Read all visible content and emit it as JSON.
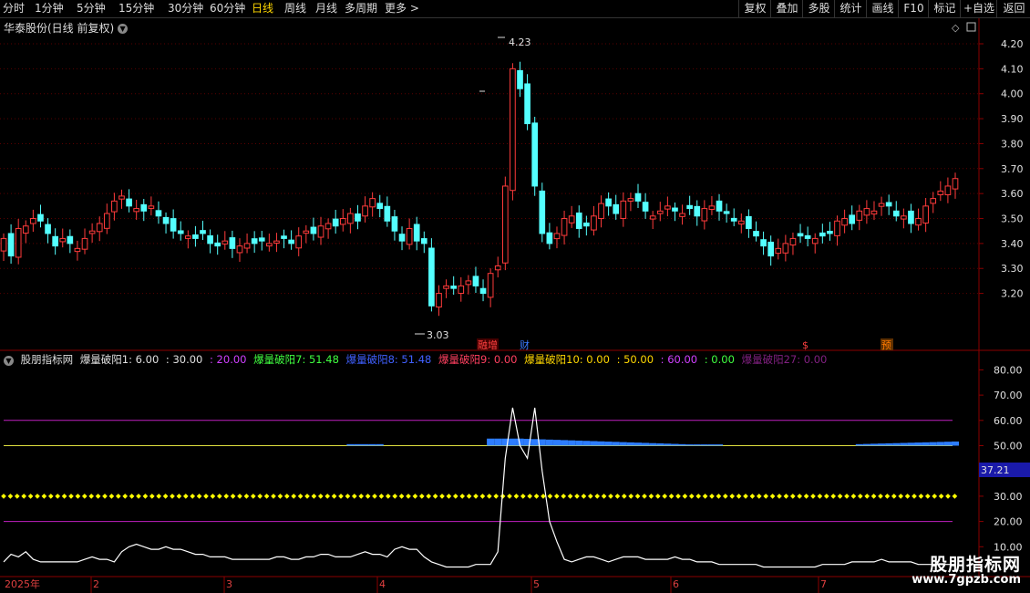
{
  "toolbar": {
    "periods": [
      "分时",
      "1分钟",
      "5分钟",
      "15分钟",
      "30分钟",
      "60分钟",
      "日线",
      "周线",
      "月线",
      "多周期",
      "更多 >"
    ],
    "active_period": "日线",
    "right_buttons": [
      "复权",
      "叠加",
      "多股",
      "统计",
      "画线",
      "F10",
      "标记",
      "+自选",
      "返回"
    ]
  },
  "main_panel": {
    "title": "华泰股份(日线 前复权)",
    "high_label": "4.23",
    "low_label": "3.03",
    "y_ticks": [
      "4.20",
      "4.10",
      "4.00",
      "3.90",
      "3.80",
      "3.70",
      "3.60",
      "3.50",
      "3.40",
      "3.30",
      "3.20"
    ],
    "markers": [
      {
        "text": "融增",
        "color": "#ff4040"
      },
      {
        "text": "财",
        "color": "#3a7bff"
      },
      {
        "text": "$",
        "color": "#ff4040"
      },
      {
        "text": "预",
        "color": "#ff7a00"
      }
    ]
  },
  "indicator_panel": {
    "title": "股朋指标网",
    "parts": [
      {
        "text": "爆量破阳1: 6.00",
        "color": "#e0e0e0"
      },
      {
        "text": ": 30.00",
        "color": "#e0e0e0"
      },
      {
        "text": ": 20.00",
        "color": "#d040ff"
      },
      {
        "text": "爆量破阳7: 51.48",
        "color": "#40ff40"
      },
      {
        "text": "爆量破阳8: 51.48",
        "color": "#4060ff"
      },
      {
        "text": "爆量破阳9: 0.00",
        "color": "#ff4060"
      },
      {
        "text": "爆量破阳10: 0.00",
        "color": "#ffd700"
      },
      {
        "text": ": 50.00",
        "color": "#ffd700"
      },
      {
        "text": ": 60.00",
        "color": "#d040ff"
      },
      {
        "text": ": 0.00",
        "color": "#40ff40"
      },
      {
        "text": "爆量破阳27: 0.00",
        "color": "#802080"
      }
    ],
    "y_ticks": [
      "80.00",
      "70.00",
      "60.00",
      "50.00",
      "30.00",
      "20.00",
      "10.00"
    ],
    "current_value": "37.21"
  },
  "date_axis": [
    "2025年",
    "2",
    "3",
    "4",
    "5",
    "6",
    "7"
  ],
  "watermark": {
    "name": "股朋指标网",
    "url": "www.7gpzb.com"
  },
  "colors": {
    "up": "#ff3b3b",
    "down": "#54ffff",
    "grid": "#8b0000",
    "ma_line": "#ffffff"
  }
}
